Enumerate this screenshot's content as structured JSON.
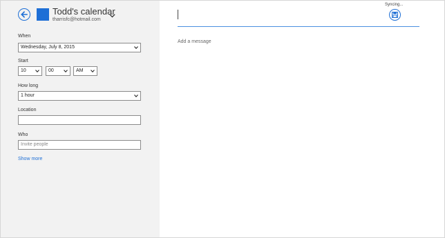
{
  "calendar": {
    "name": "Todd's calendar",
    "email": "tharrisfc@hotmail.com",
    "color": "#1e6fd6"
  },
  "form": {
    "when": {
      "label": "When",
      "value": "Wednesday, July 8, 2015"
    },
    "start": {
      "label": "Start",
      "hour": "10",
      "minute": "00",
      "ampm": "AM"
    },
    "how_long": {
      "label": "How long",
      "value": "1 hour"
    },
    "location": {
      "label": "Location",
      "value": ""
    },
    "who": {
      "label": "Who",
      "placeholder": "Invite people"
    },
    "show_more": "Show more"
  },
  "editor": {
    "status": "Syncing...",
    "message_placeholder": "Add a message"
  },
  "icons": {
    "back": "back-arrow-icon",
    "save": "save-icon",
    "dropdown": "chevron-down-icon"
  }
}
